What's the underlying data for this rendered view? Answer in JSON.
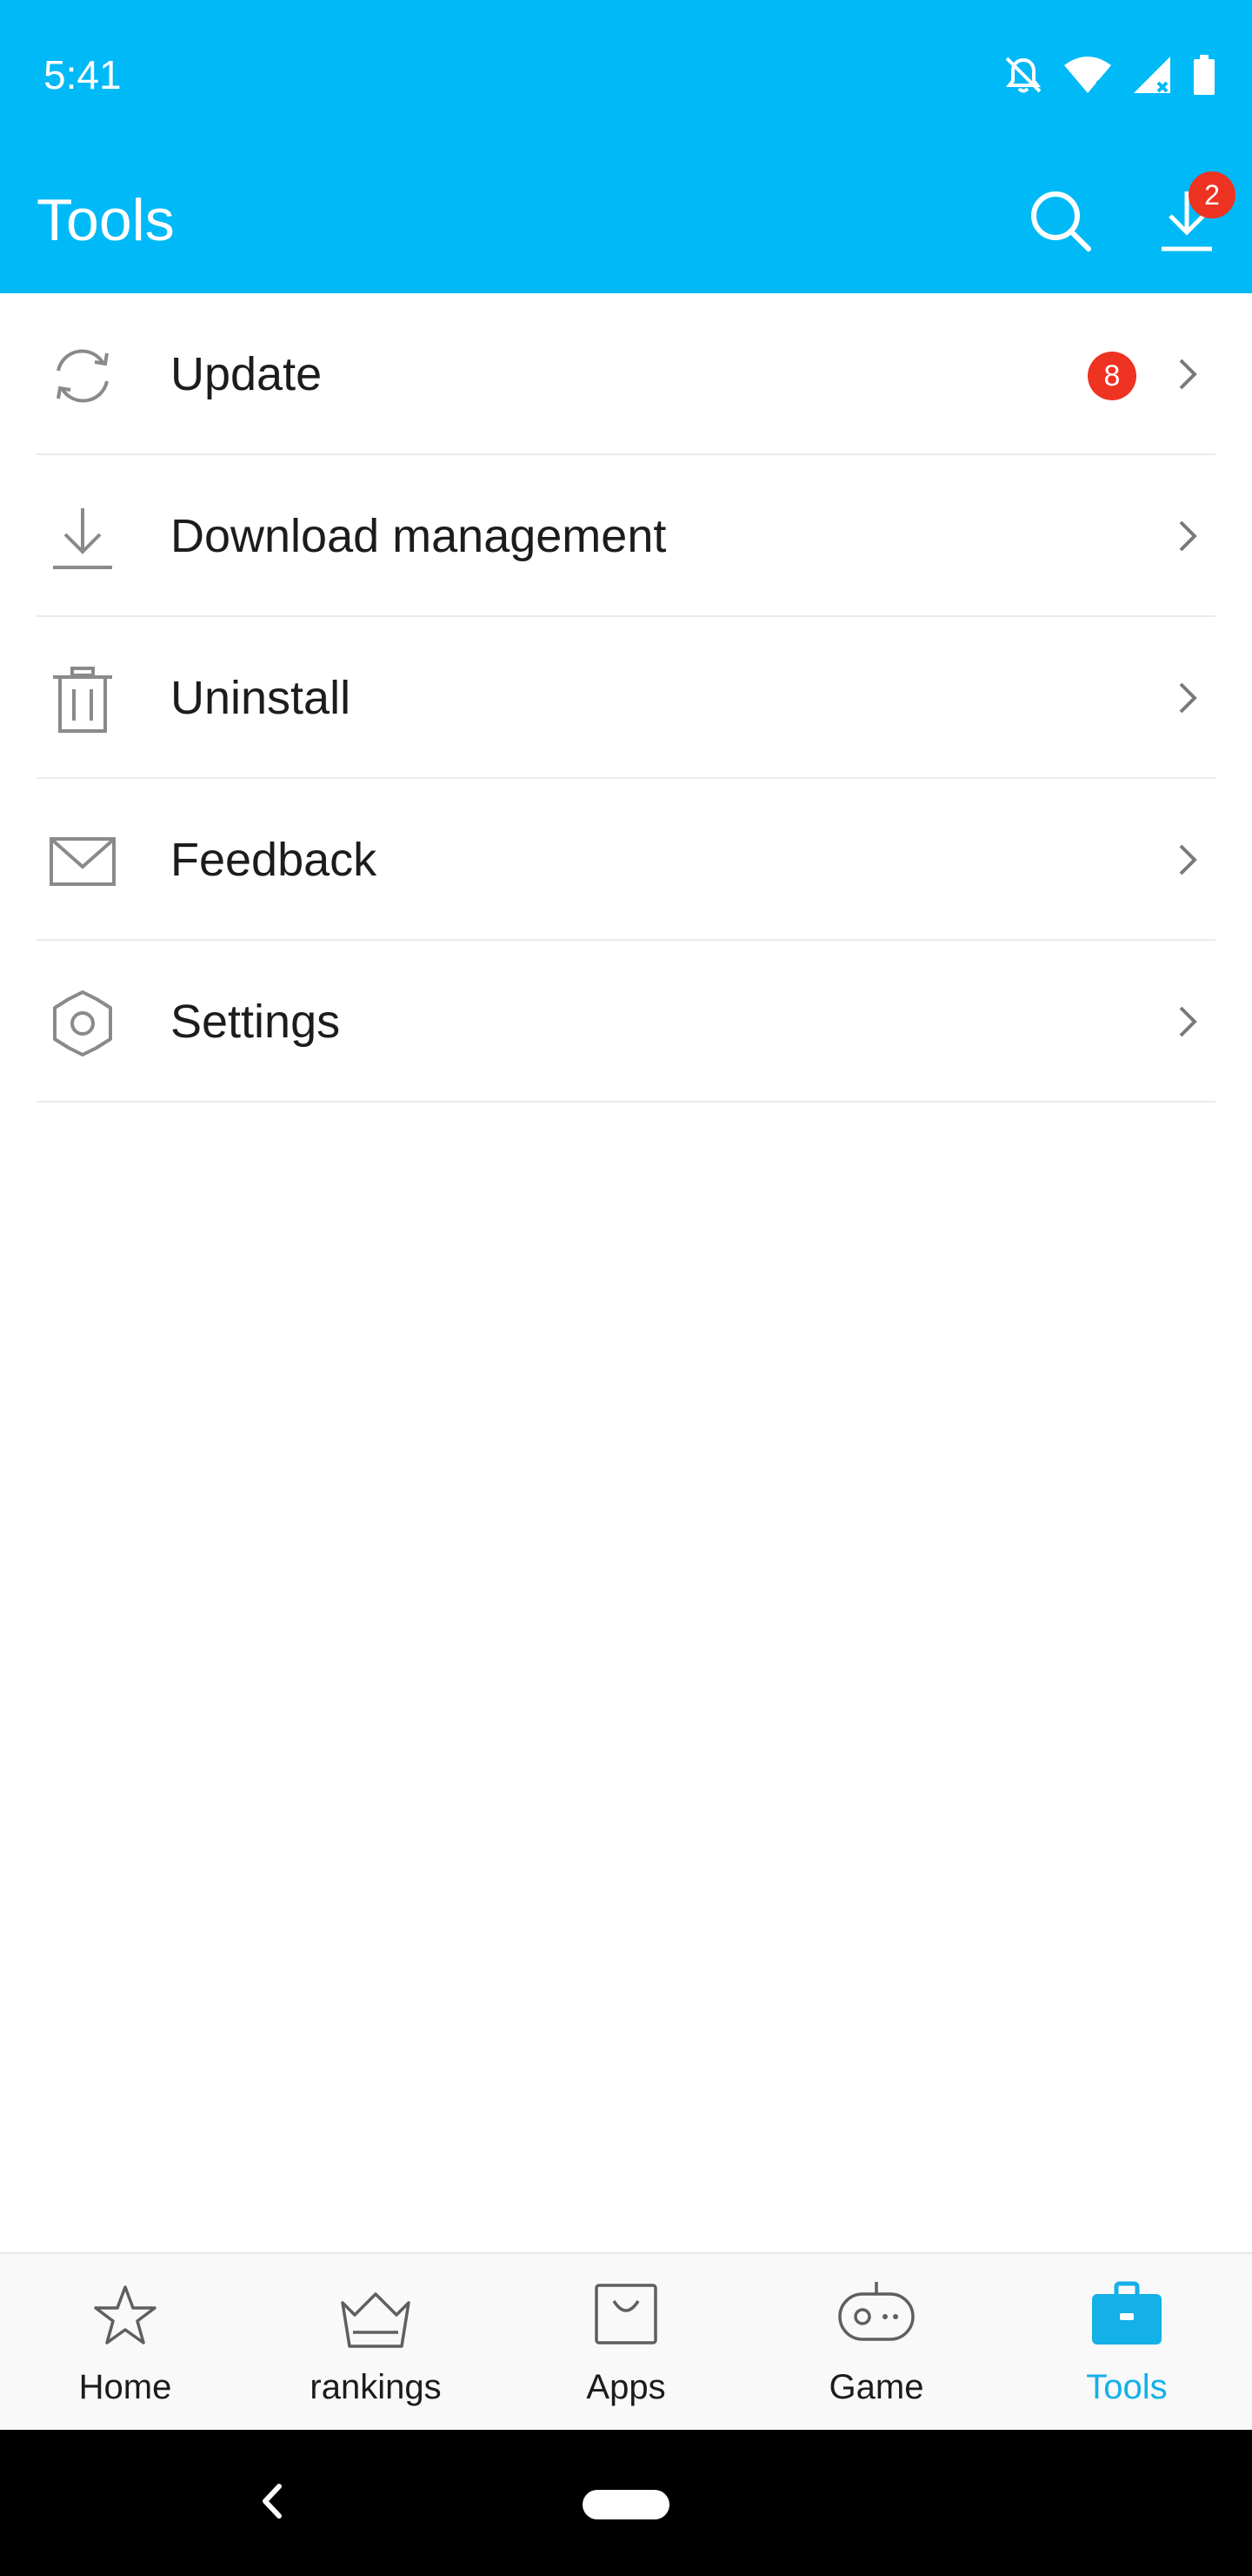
{
  "status_bar": {
    "time": "5:41",
    "icons": [
      "notifications-off-icon",
      "wifi-icon",
      "signal-icon",
      "battery-icon"
    ]
  },
  "app_bar": {
    "title": "Tools",
    "search_icon": "search-icon",
    "download_icon": "download-icon",
    "download_badge": "2"
  },
  "tools_list": {
    "items": [
      {
        "label": "Update",
        "icon": "refresh-icon",
        "badge": "8"
      },
      {
        "label": "Download management",
        "icon": "download-icon",
        "badge": ""
      },
      {
        "label": "Uninstall",
        "icon": "trash-icon",
        "badge": ""
      },
      {
        "label": "Feedback",
        "icon": "mail-icon",
        "badge": ""
      },
      {
        "label": "Settings",
        "icon": "gear-icon",
        "badge": ""
      }
    ]
  },
  "bottom_nav": {
    "active": "Tools",
    "items": [
      {
        "label": "Home",
        "icon": "star-icon"
      },
      {
        "label": "rankings",
        "icon": "crown-icon"
      },
      {
        "label": "Apps",
        "icon": "shopping-bag-icon"
      },
      {
        "label": "Game",
        "icon": "gamepad-icon"
      },
      {
        "label": "Tools",
        "icon": "toolbox-icon"
      }
    ]
  },
  "colors": {
    "primary": "#00b9f7",
    "badge": "#ee3323",
    "active_tab": "#14b0e8",
    "icon_gray": "#8a8a8a",
    "nav_icon": "#5f5f5f"
  }
}
